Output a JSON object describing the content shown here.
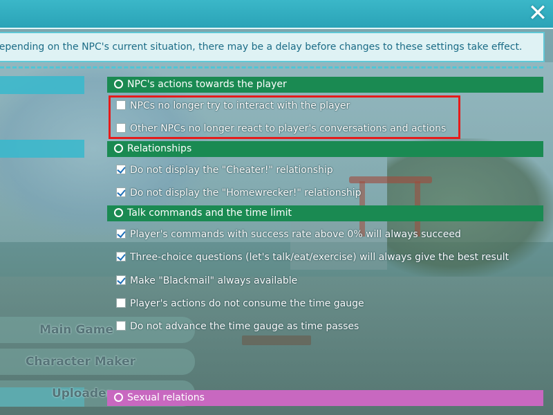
{
  "header": {
    "close_icon": "close-icon",
    "notice": "Depending on the NPC's current situation, there may be a delay before changes to these settings take effect."
  },
  "sidebar": {
    "items": [
      {
        "label": "Main Game"
      },
      {
        "label": "Character Maker"
      },
      {
        "label": "Uploader"
      }
    ]
  },
  "sections": [
    {
      "title": "NPC's actions towards the player",
      "options": [
        {
          "label": "NPCs no longer try to interact with the player",
          "checked": false
        },
        {
          "label": "Other NPCs no longer react to player's conversations and actions",
          "checked": false
        }
      ]
    },
    {
      "title": "Relationships",
      "options": [
        {
          "label": "Do not display the \"Cheater!\" relationship",
          "checked": true
        },
        {
          "label": "Do not display the \"Homewrecker!\" relationship",
          "checked": true
        }
      ]
    },
    {
      "title": "Talk commands and the time limit",
      "options": [
        {
          "label": "Player's commands with success rate above 0% will always succeed",
          "checked": true
        },
        {
          "label": "Three-choice questions (let's talk/eat/exercise) will always give the best result",
          "checked": true
        },
        {
          "label": "Make \"Blackmail\" always available",
          "checked": true
        },
        {
          "label": "Player's actions do not consume the time gauge",
          "checked": false
        },
        {
          "label": "Do not advance the time gauge as time passes",
          "checked": false
        }
      ]
    },
    {
      "title": "Sexual relations",
      "options": []
    }
  ],
  "colors": {
    "section_green": "#1a8a52",
    "section_pink": "#c868c0",
    "highlight": "#e51b1b",
    "header": "#2aa3b7"
  }
}
